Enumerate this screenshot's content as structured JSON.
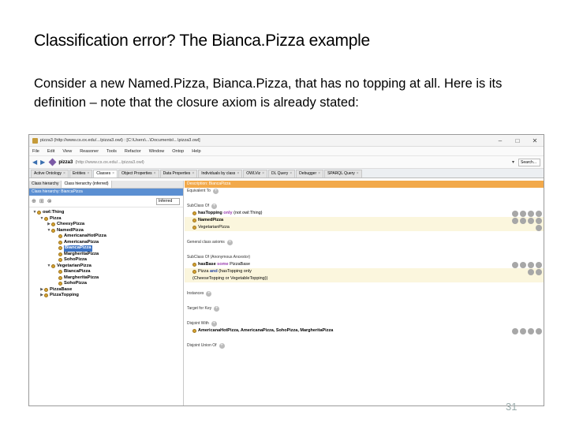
{
  "slide": {
    "title": "Classification error? The Bianca.Pizza example",
    "body": "Consider a new Named.Pizza, Bianca.Pizza, that has no topping at all. Here is its definition – note that the closure axiom is already stated:",
    "page_number": "31"
  },
  "window": {
    "title": "pizza3 (http://www.cs.ox.edu/.../pizza3.owl) : [C:\\Users\\...\\Documents\\...\\pizza3.owl]",
    "controls": [
      "–",
      "□",
      "✕"
    ]
  },
  "menubar": [
    "File",
    "Edit",
    "View",
    "Reasoner",
    "Tools",
    "Refactor",
    "Window",
    "Ontop",
    "Help"
  ],
  "toolbar": {
    "ontology_name": "pizza3",
    "ontology_url": "(http://www.cs.ox.edu/.../pizza3.owl)",
    "search_label": "Search..."
  },
  "tabs": [
    "Active Ontology",
    "Entities",
    "Classes",
    "Object Properties",
    "Data Properties",
    "Individuals by class",
    "OWLViz",
    "DL Query",
    "Debugger",
    "SPARQL Query"
  ],
  "left_pane": {
    "subtabs": [
      "Class hierarchy",
      "Class hierarchy (inferred)"
    ],
    "header": "Class hierarchy: BiancaPizza",
    "view_mode": "Inferred",
    "tree": [
      {
        "label": "owl:Thing",
        "level": 0,
        "toggle": "▼"
      },
      {
        "label": "Pizza",
        "level": 1,
        "toggle": "▼"
      },
      {
        "label": "CheesyPizza",
        "level": 2,
        "toggle": "▶"
      },
      {
        "label": "NamedPizza",
        "level": 2,
        "toggle": "▼"
      },
      {
        "label": "AmericanaHotPizza",
        "level": 3,
        "toggle": ""
      },
      {
        "label": "AmericanaPizza",
        "level": 3,
        "toggle": ""
      },
      {
        "label": "BiancaPizza",
        "level": 3,
        "toggle": "",
        "selected": true
      },
      {
        "label": "MargheritaPizza",
        "level": 3,
        "toggle": ""
      },
      {
        "label": "SohoPizza",
        "level": 3,
        "toggle": ""
      },
      {
        "label": "VegetarianPizza",
        "level": 2,
        "toggle": "▼"
      },
      {
        "label": "BiancaPizza",
        "level": 3,
        "toggle": ""
      },
      {
        "label": "MargheritaPizza",
        "level": 3,
        "toggle": ""
      },
      {
        "label": "SohoPizza",
        "level": 3,
        "toggle": ""
      },
      {
        "label": "PizzaBase",
        "level": 1,
        "toggle": "▶"
      },
      {
        "label": "PizzaTopping",
        "level": 1,
        "toggle": "▶"
      }
    ]
  },
  "right_pane": {
    "header": "Description: BiancaPizza",
    "equivalent_to": "Equivalent To",
    "subclass_of_label": "SubClass Of",
    "subclass_of": [
      {
        "prop": "hasTopping",
        "kw": "only",
        "rest": "(not owl:Thing)"
      },
      {
        "name": "NamedPizza"
      },
      {
        "name": "VegetarianPizza"
      }
    ],
    "general_axioms": "General class axioms",
    "subclass_anonymous_label": "SubClass Of (Anonymous Ancestor)",
    "anonymous": [
      {
        "prop": "hasBase",
        "kw": "some",
        "rest": "PizzaBase"
      },
      {
        "line1_pre": "Pizza",
        "kw": "and",
        "line1_post": "(hasTopping only",
        "line2": "(CheeseTopping or VegetableTopping))"
      }
    ],
    "instances": "Instances",
    "target_for_key": "Target for Key",
    "disjoint_with": "Disjoint With",
    "disjoint_value": "AmericanaHotPizza, AmericanaPizza, SohoPizza, MargheritaPizza",
    "disjoint_union_of": "Disjoint Union Of"
  },
  "colors": {
    "class_header": "#5b8fd2",
    "description_header": "#f2a94a",
    "class_dot": "#d6a230"
  }
}
